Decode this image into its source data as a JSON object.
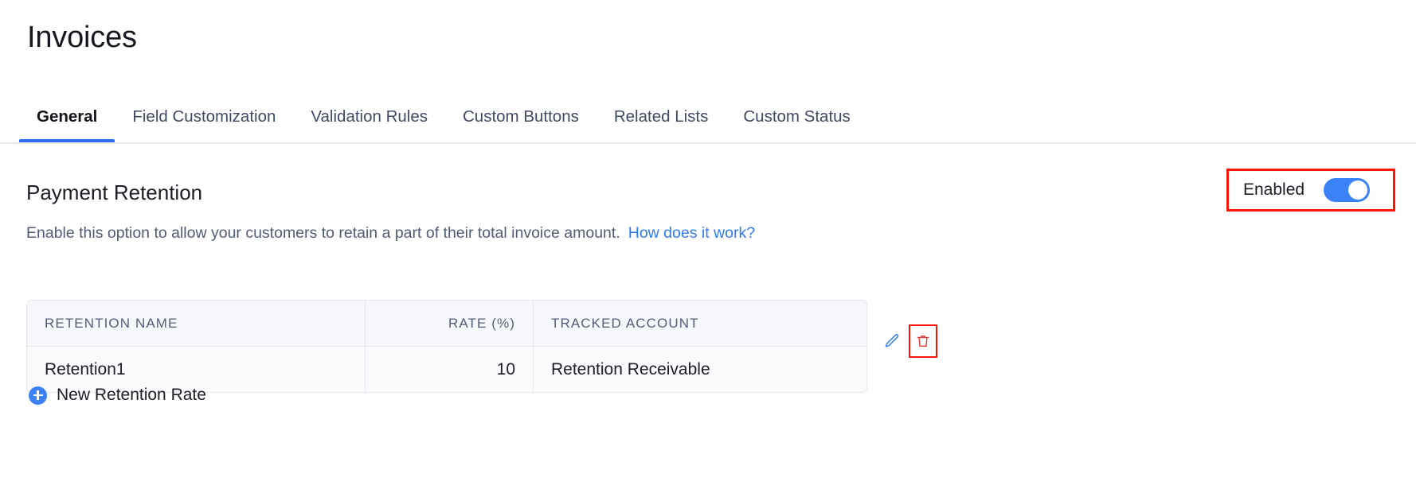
{
  "header": {
    "title": "Invoices"
  },
  "tabs": [
    {
      "label": "General",
      "active": true
    },
    {
      "label": "Field Customization",
      "active": false
    },
    {
      "label": "Validation Rules",
      "active": false
    },
    {
      "label": "Custom Buttons",
      "active": false
    },
    {
      "label": "Related Lists",
      "active": false
    },
    {
      "label": "Custom Status",
      "active": false
    }
  ],
  "section": {
    "title": "Payment Retention",
    "description": "Enable this option to allow your customers to retain a part of their total invoice amount.",
    "help_link": "How does it work?",
    "toggle": {
      "label": "Enabled",
      "state": "on",
      "highlighted": true
    }
  },
  "table": {
    "columns": [
      "RETENTION NAME",
      "RATE (%)",
      "TRACKED ACCOUNT"
    ],
    "rows": [
      {
        "retention_name": "Retention1",
        "rate": "10",
        "tracked_account": "Retention Receivable"
      }
    ],
    "actions": {
      "edit_icon": "pencil-icon",
      "delete_icon": "trash-icon",
      "delete_highlighted": true
    }
  },
  "footer": {
    "add_label": "New Retention Rate",
    "add_icon": "plus-circle-icon"
  },
  "colors": {
    "accent": "#3b82f6",
    "link": "#2f7bf6",
    "highlight": "#fd1505",
    "danger": "#e23a35",
    "text": "#1b1e27",
    "muted": "#525b73"
  }
}
